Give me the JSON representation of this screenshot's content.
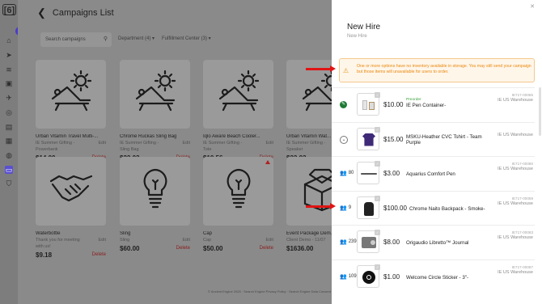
{
  "rail": {
    "logo": "[6]",
    "expand_icon": "chevron-right"
  },
  "page": {
    "title": "Campaigns List",
    "search_placeholder": "Search campaigns",
    "filters": [
      "Department (4) ▾",
      "Fulfillment Center (3) ▾"
    ],
    "edit_label": "Edit",
    "delete_label": "Delete",
    "cards": [
      {
        "name": "Urban Vitamin Travel Multi-...",
        "sub1": "IE Summer Gifting -",
        "sub2": "Powerbank",
        "price": "$14.00",
        "icon": "beach-chair"
      },
      {
        "name": "Chrome Ruckas Sling Bag",
        "sub1": "IE Summer Gifting -",
        "sub2": "Sling Bag",
        "price": "$22.03",
        "icon": "beach-chair"
      },
      {
        "name": "Iqlo Aware Beach Cooler...",
        "sub1": "IE Summer Gifting -",
        "sub2": "Tote",
        "price": "$10.56",
        "icon": "beach-chair"
      },
      {
        "name": "Urban Vitamin Wat...",
        "sub1": "IE Summer Gifting -",
        "sub2": "Speaker",
        "price": "$23.03",
        "icon": "beach-chair"
      },
      {
        "name": "Waterbottle",
        "sub1": "Thank you for meeting",
        "sub2": "with us!",
        "price": "$9.18",
        "icon": "handshake"
      },
      {
        "name": "Sling",
        "sub1": "Sling",
        "sub2": "",
        "price": "$60.00",
        "icon": "lightbulb"
      },
      {
        "name": "Cap",
        "sub1": "Cap",
        "sub2": "",
        "price": "$50.00",
        "icon": "lightbulb"
      },
      {
        "name": "Event Package Dem...",
        "sub1": "Client Demo - 11/07",
        "sub2": "",
        "price": "$1636.00",
        "icon": "diamond-box"
      }
    ],
    "footer": "© Ancient Engine 2025 · Search Engine Privacy Policy · Search Engine Data Consent"
  },
  "drawer": {
    "title": "New Hire",
    "subtitle": "New Hire",
    "warning": "One or more options have no inventory available in storage. You may still send your campaign but those items will unavailable for users to order.",
    "items": [
      {
        "lead": "",
        "lead_icon": "pencil-badge",
        "price": "$10.00",
        "prefix": "Preorder",
        "name": "IE Pen Container-",
        "sku": "IE717-00085",
        "warehouse": "IE US Warehouse"
      },
      {
        "lead": "",
        "lead_icon": "chevron-down-circle",
        "price": "$15.00",
        "prefix": "",
        "name": "MSKU-Heather CVC Tshirt - Team Purple",
        "sku": "",
        "warehouse": "IE US Warehouse"
      },
      {
        "lead": "80",
        "lead_icon": "users",
        "price": "$3.00",
        "prefix": "",
        "name": "Aquarius Comfort Pen",
        "sku": "IE717-00080",
        "warehouse": "IE US Warehouse"
      },
      {
        "lead": "9",
        "lead_icon": "users-warning",
        "price": "$100.00",
        "prefix": "",
        "name": "Chrome Naito Backpack - Smoke-",
        "sku": "IE717-00059",
        "warehouse": "IE US Warehouse"
      },
      {
        "lead": "239",
        "lead_icon": "users",
        "price": "$8.00",
        "prefix": "",
        "name": "Origaudio Libretto™ Journal",
        "sku": "IE717-00083",
        "warehouse": "IE US Warehouse"
      },
      {
        "lead": "109",
        "lead_icon": "users",
        "price": "$1.00",
        "prefix": "",
        "name": "Welcome Circle Sticker - 3\"-",
        "sku": "IE717-00087",
        "warehouse": "IE US Warehouse"
      }
    ]
  },
  "colors": {
    "accent": "#4a3cc9",
    "warning_text": "#e8890e",
    "warning_bg": "#fff6ea",
    "delete": "#8a2020",
    "annotation_arrow": "#e01414"
  }
}
